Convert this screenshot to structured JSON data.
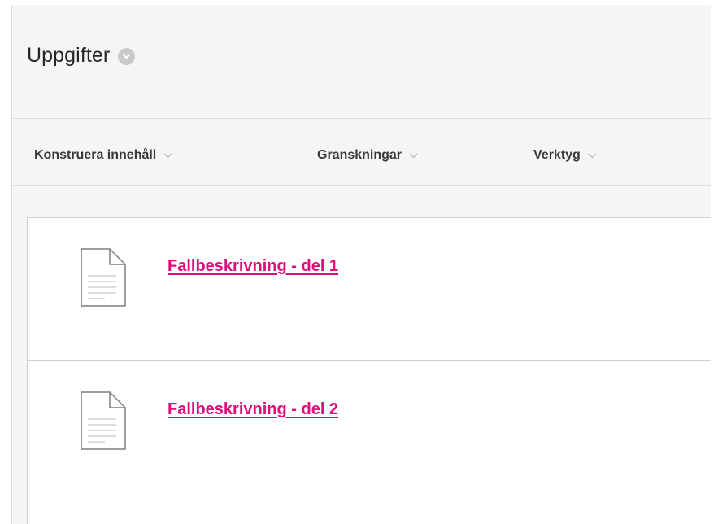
{
  "page": {
    "title": "Uppgifter",
    "title_menu_icon": "chevron-down-circle-icon"
  },
  "toolbar": {
    "items": [
      {
        "label": "Konstruera innehåll",
        "icon": "chevron-down-icon"
      },
      {
        "label": "Granskningar",
        "icon": "chevron-down-icon"
      },
      {
        "label": "Verktyg",
        "icon": "chevron-down-icon"
      }
    ]
  },
  "content": {
    "items": [
      {
        "title": "Fallbeskrivning - del 1",
        "icon": "document-icon"
      },
      {
        "title": "Fallbeskrivning - del 2",
        "icon": "document-icon"
      }
    ]
  },
  "colors": {
    "link": "#e20b7a",
    "background": "#f5f5f5",
    "content_background": "#ffffff"
  }
}
